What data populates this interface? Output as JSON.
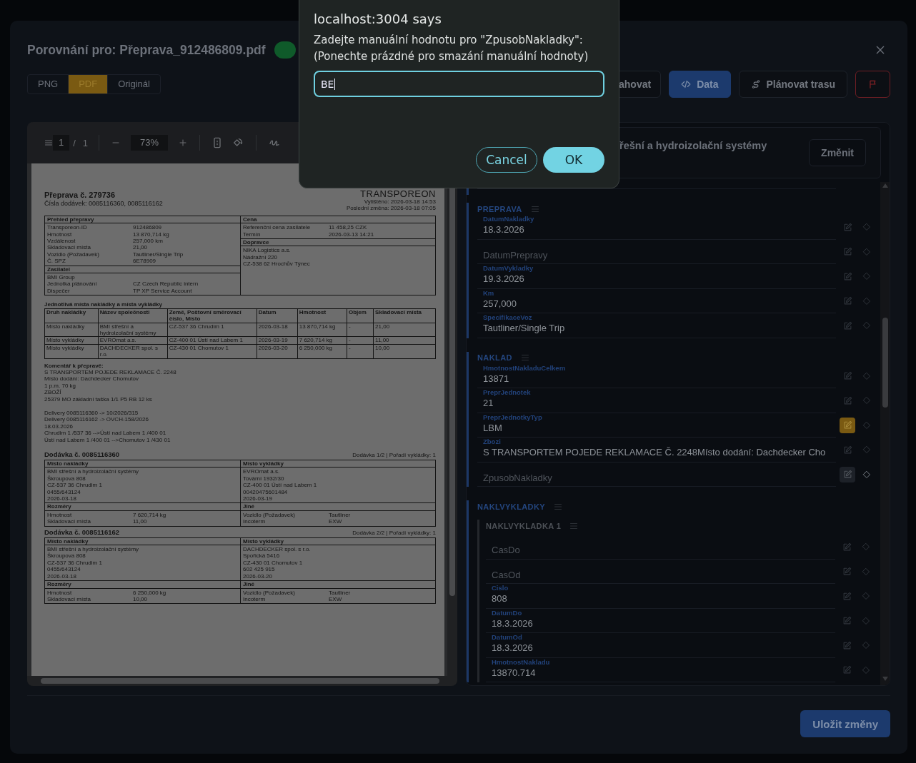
{
  "dialog": {
    "title": "localhost:3004 says",
    "message": [
      "Zadejte manuální hodnotu pro \"ZpusobNakladky\":",
      "(Ponechte prázdné pro smazání manuální hodnoty)"
    ],
    "value": "BE",
    "buttons": [
      {
        "label": "Cancel",
        "kind": "secondary"
      },
      {
        "label": "OK",
        "kind": "primary"
      }
    ]
  },
  "header": {
    "title": "Porovnání pro: Přeprava_912486809.pdf"
  },
  "view_tabs": [
    {
      "label": "PNG",
      "selected": false
    },
    {
      "label": "PDF",
      "selected": true
    },
    {
      "label": "Originál",
      "selected": false
    }
  ],
  "actions": [
    {
      "kind": "cut",
      "label": "ahovat"
    },
    {
      "kind": "data",
      "label": "Data"
    },
    {
      "kind": "route",
      "label": "Plánovat trasu"
    },
    {
      "kind": "flag"
    }
  ],
  "pdf_viewer": {
    "page": "1",
    "page_separator": "/",
    "pages": "1",
    "zoom": "73%"
  },
  "document": {
    "title": "Přeprava č. 279736",
    "subtitle": "Čísla dodávek: 0085116360, 0085116162",
    "brand": "TRANSPOREON",
    "meta": [
      "Vytištěno: 2026-03-18 14:53",
      "Poslední změna: 2026-03-18 07:05"
    ],
    "boxes_left": [
      {
        "heading": "Přehled přepravy",
        "rows": [
          {
            "key": "Transporeon-ID",
            "value": "912486809"
          },
          {
            "key": "Hmotnost",
            "value": "13 870,714 kg"
          },
          {
            "key": "Vzdálenost",
            "value": "257,000 km"
          },
          {
            "key": "Skladovací místa",
            "value": "21,00"
          },
          {
            "key": "Vozidlo (Požadavek)",
            "value": "Tautliner/Single Trip"
          },
          {
            "key": "Č. SPZ",
            "value": "6E78909"
          }
        ]
      },
      {
        "heading": "Zasilatel",
        "rows": [
          {
            "key": "BMI Group"
          },
          {
            "key": "Jednotka plánování",
            "value": "CZ Czech Republic intern"
          },
          {
            "key": "Dispečer",
            "value": "TP XP Service Account"
          }
        ]
      }
    ],
    "boxes_right": [
      {
        "heading": "Cena",
        "rows": [
          {
            "key": "Referenční cena zasilatele",
            "value": "11 458,25 CZK"
          },
          {
            "key": "Termín",
            "value": "2026-03-13 14:21"
          }
        ]
      },
      {
        "heading": "Dopravce",
        "rows": [
          {
            "key": "NIKA Logistics a.s."
          },
          {
            "key": "Nádražní 220"
          },
          {
            "key": "CZ-538 62 Hrochův Týnec"
          }
        ]
      }
    ],
    "stops": {
      "heading": "Jednotlivá místa nakládky a místa vykládky",
      "columns": [
        "Druh nakládky",
        "Název společnosti",
        "Země, Poštovní směrovací číslo, Místo",
        "Datum",
        "Hmotnost",
        "Objem",
        "Skladovací místa"
      ],
      "rows": [
        [
          "Místo nakládky",
          "BMI střešní a hydroizolační systémy",
          "CZ-537 36 Chrudim 1",
          "2026-03-18",
          "13 870,714 kg",
          "-",
          "21,00"
        ],
        [
          "Místo vykládky",
          "EVROmat a.s.",
          "CZ-400 01 Ústí nad Labem 1",
          "2026-03-19",
          "7 620,714 kg",
          "-",
          "11,00"
        ],
        [
          "Místo vykládky",
          "DACHDECKER spol. s r.o.",
          "CZ-430 01 Chomutov 1",
          "2026-03-20",
          "6 250,000 kg",
          "-",
          "10,00"
        ]
      ]
    },
    "comment": {
      "heading": "Komentář k přepravě:",
      "paragraphs": [
        [
          "S TRANSPORTEM POJEDE REKLAMACE Č. 2248",
          "Místo dodání: Dachdecker Chomutov",
          "1 p.m. 70 kg",
          "ZBOŽÍ",
          "25379 MO základní taška 1/1 P5 RB 12 ks"
        ],
        [
          "Delivery 0085116360 -> 10/2026/315",
          "Delivery 0085116162 -> OVCH-158/2026",
          "18.03.2026",
          "Chrudim 1 /537 36 -->Ústí nad Labem 1 /400 01",
          "Ústí nad Labem 1 /400 01 -->Chomutov 1 /430 01"
        ]
      ]
    },
    "deliveries": [
      {
        "title": "Dodávka č. 0085116360",
        "meta": "Dodávka 1/2 | Pořadí vykládky: 1",
        "load": {
          "heading": "Místo nakládky",
          "lines": [
            "BMI střešní a hydroizolační systémy",
            "Škroupova 808",
            "CZ-537 36 Chrudim 1",
            "0455/643124",
            "2026-03-18"
          ]
        },
        "unload": {
          "heading": "Místo vykládky",
          "lines": [
            "EVROmat a.s.",
            "Tovární 1932/30",
            "CZ-400 01 Ústí nad Labem 1",
            "00420475601484",
            "2026-03-19"
          ]
        },
        "dims": {
          "heading": "Rozměry",
          "rows": [
            {
              "key": "Hmotnost",
              "value": "7 620,714 kg"
            },
            {
              "key": "Skladovací místa",
              "value": "11,00"
            }
          ]
        },
        "other": {
          "heading": "Jiné",
          "rows": [
            {
              "key": "Vozidlo (Požadavek)",
              "value": "Tautliner"
            },
            {
              "key": "Incoterm",
              "value": "EXW"
            }
          ]
        }
      },
      {
        "title": "Dodávka č. 0085116162",
        "meta": "Dodávka 2/2 | Pořadí vykládky: 1",
        "load": {
          "heading": "Místo nakládky",
          "lines": [
            "BMI střešní a hydroizolační systémy",
            "Škroupova 808",
            "CZ-537 36 Chrudim 1",
            "0455/643124",
            "2026-03-18"
          ]
        },
        "unload": {
          "heading": "Místo vykládky",
          "lines": [
            "DACHDECKER spol. s r.o.",
            "Spořická 5416",
            "CZ-430 01 Chomutov 1",
            "602 425 915",
            "2026-03-20"
          ]
        },
        "dims": {
          "heading": "Rozměry",
          "rows": [
            {
              "key": "Hmotnost",
              "value": "6 250,000 kg"
            },
            {
              "key": "Skladovací místa",
              "value": "10,00"
            }
          ]
        },
        "other": {
          "heading": "Jiné",
          "rows": [
            {
              "key": "Vozidlo (Požadavek)",
              "value": "Tautliner"
            },
            {
              "key": "Incoterm",
              "value": "EXW"
            }
          ]
        }
      }
    ]
  },
  "record_card": {
    "title": "řešní a hydroizolační systémy",
    "button": "Změnit"
  },
  "sections": [
    {
      "title": "PREPRAVA",
      "fields": [
        {
          "label": "DatumNakladky",
          "value": "18.3.2026",
          "manual": false,
          "editing": false
        },
        {
          "placeholder": "DatumPrepravy",
          "manual": false,
          "editing": false
        },
        {
          "label": "DatumVykladky",
          "value": "19.3.2026",
          "manual": false,
          "editing": false
        },
        {
          "label": "Km",
          "value": "257,000",
          "manual": false,
          "editing": false
        },
        {
          "label": "SpecifikaceVoz",
          "value": "Tautliner/Single Trip",
          "manual": false,
          "editing": false
        }
      ]
    },
    {
      "title": "NAKLAD",
      "fields": [
        {
          "label": "HmotnostNakladuCelkem",
          "value": "13871",
          "manual": false,
          "editing": false
        },
        {
          "label": "PreprJednotek",
          "value": "21",
          "manual": false,
          "editing": false
        },
        {
          "label": "PreprJednotkyTyp",
          "value": "LBM",
          "manual": true,
          "editing": false
        },
        {
          "label": "Zbozi",
          "value": "S TRANSPORTEM POJEDE REKLAMACE Č. 2248Místo dodání: Dachdecker Cho",
          "manual": false,
          "editing": false
        },
        {
          "placeholder": "ZpusobNakladky",
          "manual": false,
          "editing": true
        }
      ]
    },
    {
      "title": "NAKLVYKLADKY",
      "children": [
        {
          "title": "NAKLVYKLADKA 1",
          "fields": [
            {
              "placeholder": "CasDo",
              "manual": false,
              "editing": false
            },
            {
              "placeholder": "CasOd",
              "manual": false,
              "editing": false
            },
            {
              "label": "Cislo",
              "value": "808",
              "manual": false,
              "editing": false
            },
            {
              "label": "DatumDo",
              "value": "18.3.2026",
              "manual": false,
              "editing": false
            },
            {
              "label": "DatumOd",
              "value": "18.3.2026",
              "manual": false,
              "editing": false
            },
            {
              "label": "HmotnostNakladu",
              "value": "13870.714",
              "manual": false,
              "editing": false
            }
          ]
        }
      ]
    }
  ],
  "save_button": "Uložit změny"
}
